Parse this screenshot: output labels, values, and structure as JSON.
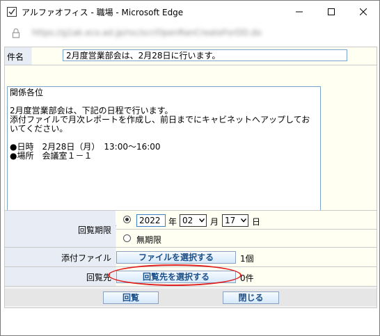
{
  "window": {
    "title": "アルファオフィス - 職場 - Microsoft Edge",
    "url": "https://g1ak.eco.ad.jp/rsc/scr/OpenRanCreateForDD.do"
  },
  "form": {
    "subject_label": "件名",
    "subject_value": "2月度営業部会は、2月28日に行います。",
    "body_text": "関係各位\n\n2月度営業部会は、下記の日程で行います。\n添付ファイルで月次レポートを作成し、前日までにキャビネットへアップしておいてください。\n\n●日時　2月28日（月）　13:00〜16:00\n●場所　会議室１－１",
    "deadline_label": "回覧期限",
    "year_value": "2022",
    "year_unit": "年",
    "month_value": "02",
    "month_unit": "月",
    "day_value": "17",
    "day_unit": "日",
    "no_deadline_label": "無期限",
    "attachment_label": "添付ファイル",
    "attachment_button": "ファイルを選択する",
    "attachment_count": "1個",
    "recipients_label": "回覧先",
    "recipients_button": "回覧先を選択する",
    "recipients_count": "0件"
  },
  "footer": {
    "circulate_button": "回覧",
    "close_button": "閉じる"
  },
  "colors": {
    "label_bg": "#e8ecf5",
    "field_bg": "#fffff2",
    "button_text": "#1a4f8a",
    "highlight_ring": "#e02020"
  }
}
